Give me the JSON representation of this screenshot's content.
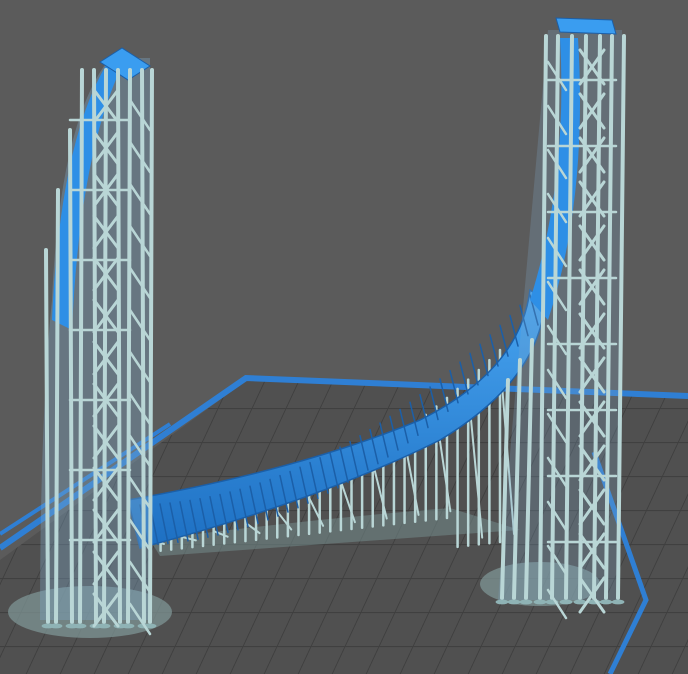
{
  "scene": {
    "description_hidden": "",
    "colors": {
      "background": "#5b5b5b",
      "build_plate": "#4f4f4f",
      "plate_grid": "#3d3d3d",
      "plate_border": "#2f7fd4",
      "support": "#b9d6d6",
      "support_shadow": "#8fb3b5",
      "model_blue": "#2e8fe6",
      "model_blue_dark": "#1d6fc2",
      "base_pad": "#8aa3a3"
    },
    "objects": [
      "build-plate",
      "left-tower-supports",
      "right-tower-supports",
      "curved-model-ramp",
      "bridge-supports"
    ]
  }
}
